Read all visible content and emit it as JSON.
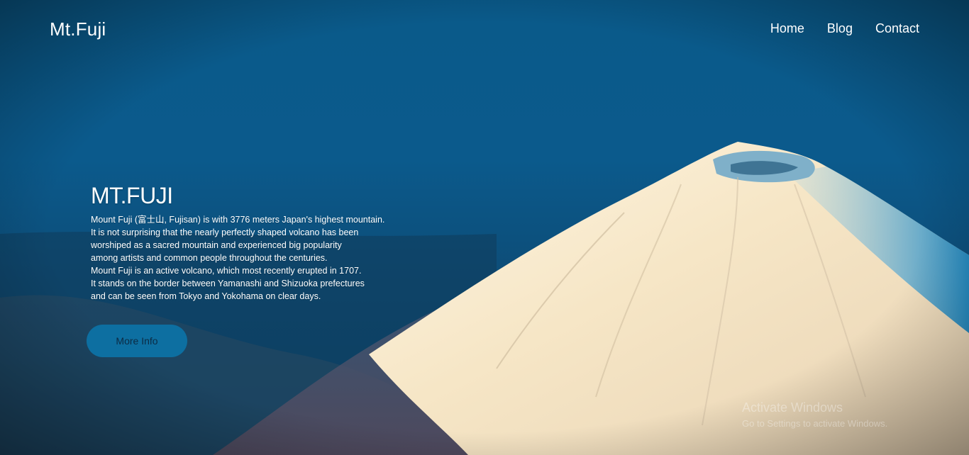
{
  "header": {
    "logo": "Mt.Fuji",
    "nav": [
      "Home",
      "Blog",
      "Contact"
    ]
  },
  "hero": {
    "title": "MT.FUJI",
    "paragraph_lines": [
      "Mount Fuji (富士山, Fujisan) is with 3776 meters Japan's highest mountain.",
      "It is not surprising that the nearly perfectly shaped volcano has been",
      "worshiped as a sacred mountain and experienced big popularity",
      "among artists and common people throughout the centuries.",
      "Mount Fuji is an active volcano, which most recently erupted in 1707.",
      "It stands on the border between Yamanashi and Shizuoka prefectures",
      "and can be seen from Tokyo and Yokohama on clear days."
    ],
    "button_label": "More Info"
  },
  "watermark": {
    "title": "Activate Windows",
    "subtitle": "Go to Settings to activate Windows."
  },
  "colors": {
    "sky_blue": "#0a5a8a",
    "button_bg": "#0d6fa1",
    "button_text": "#0c2b44",
    "snow": "#f6ead2"
  }
}
